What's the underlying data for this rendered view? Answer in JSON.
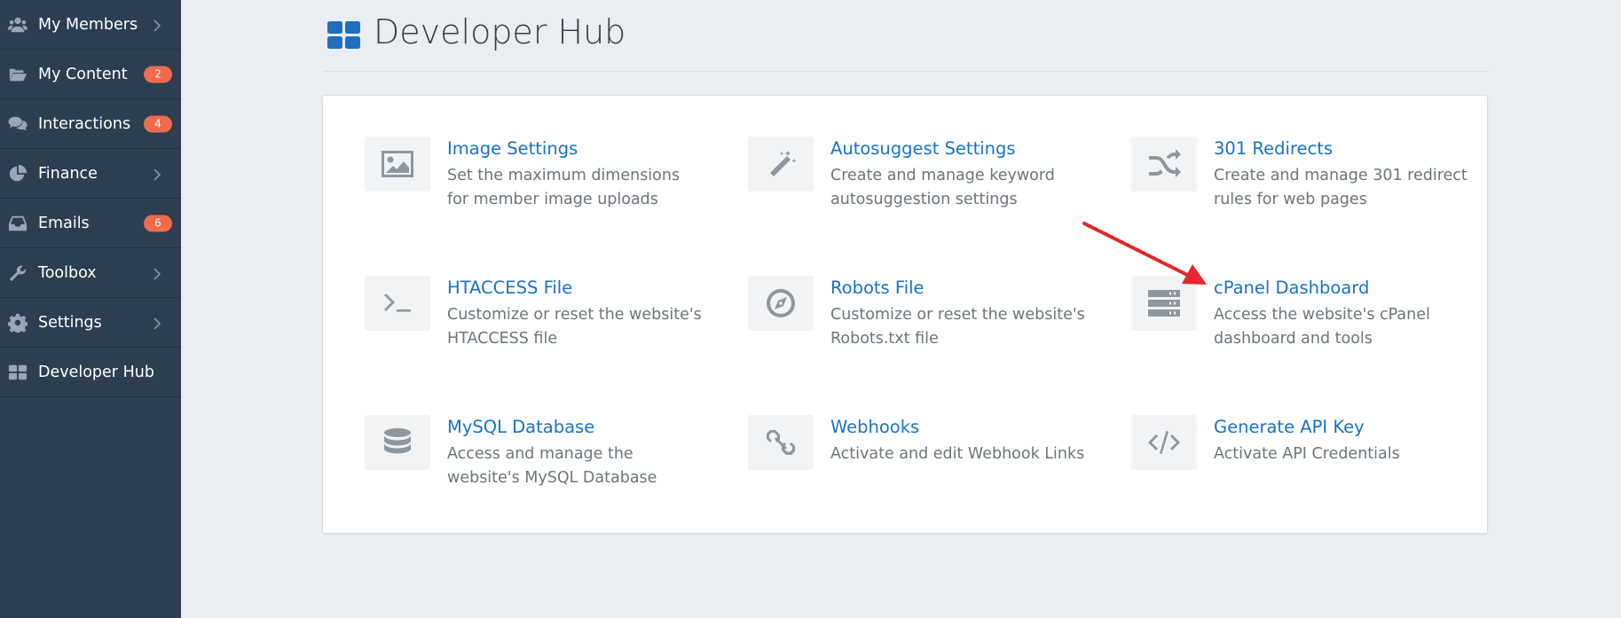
{
  "sidebar": {
    "items": [
      {
        "label": "My Members",
        "icon": "users-icon",
        "chevron": true
      },
      {
        "label": "My Content",
        "icon": "folder-open-icon",
        "badge": "2"
      },
      {
        "label": "Interactions",
        "icon": "comments-icon",
        "badge": "4"
      },
      {
        "label": "Finance",
        "icon": "pie-chart-icon",
        "chevron": true
      },
      {
        "label": "Emails",
        "icon": "inbox-icon",
        "badge": "6"
      },
      {
        "label": "Toolbox",
        "icon": "wrench-icon",
        "chevron": true
      },
      {
        "label": "Settings",
        "icon": "gear-icon",
        "chevron": true
      },
      {
        "label": "Developer Hub",
        "icon": "grid-icon",
        "active": true
      }
    ]
  },
  "header": {
    "title": "Developer Hub",
    "icon": "grid-icon"
  },
  "tiles": [
    {
      "title": "Image Settings",
      "desc": "Set the maximum dimensions for member image uploads",
      "icon": "image-icon"
    },
    {
      "title": "Autosuggest Settings",
      "desc": "Create and manage keyword autosuggestion settings",
      "icon": "magic-wand-icon"
    },
    {
      "title": "301 Redirects",
      "desc": "Create and manage 301 redirect rules for web pages",
      "icon": "shuffle-icon"
    },
    {
      "title": "HTACCESS File",
      "desc": "Customize or reset the website's HTACCESS file",
      "icon": "terminal-icon"
    },
    {
      "title": "Robots File",
      "desc": "Customize or reset the website's Robots.txt file",
      "icon": "compass-icon"
    },
    {
      "title": "cPanel Dashboard",
      "desc": "Access the website's cPanel dashboard and tools",
      "icon": "server-icon"
    },
    {
      "title": "MySQL Database",
      "desc": "Access and manage the website's MySQL Database",
      "icon": "database-icon"
    },
    {
      "title": "Webhooks",
      "desc": "Activate and edit Webhook Links",
      "icon": "link-icon"
    },
    {
      "title": "Generate API Key",
      "desc": "Activate API Credentials",
      "icon": "code-icon"
    }
  ],
  "annotation": {
    "color": "#e8262b",
    "icon": "red-arrow-icon"
  },
  "colors": {
    "sidebar": "#2c3e50",
    "badge": "#ef6b4a",
    "link": "#1a73c8",
    "accent": "#1e6fbf"
  }
}
